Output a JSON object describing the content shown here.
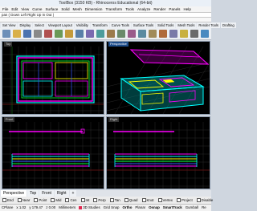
{
  "window": {
    "title": "ToolBox (3150 KB) - Rhinoceros Educational (64-bit)"
  },
  "menu": [
    "File",
    "Edit",
    "View",
    "Curve",
    "Surface",
    "Solid",
    "Mesh",
    "Dimension",
    "Transform",
    "Tools",
    "Analyze",
    "Render",
    "Panels",
    "Help"
  ],
  "command": {
    "history": "pan ( Down Left Right Up In Out )"
  },
  "toolbar_tabs": [
    "Set View",
    "Display",
    "Select",
    "Viewport Layout",
    "Visibility",
    "Transform",
    "Curve Tools",
    "Surface Tools",
    "Solid Tools",
    "Mesh Tools",
    "Render Tools",
    "Drafting"
  ],
  "toolbar_icons": [
    {
      "name": "new-icon",
      "color": "#6d8fb8"
    },
    {
      "name": "open-icon",
      "color": "#d9b04a"
    },
    {
      "name": "save-icon",
      "color": "#4a72b0"
    },
    {
      "name": "print-icon",
      "color": "#8a8a8a"
    },
    {
      "name": "cut-icon",
      "color": "#b05050"
    },
    {
      "name": "copy-icon",
      "color": "#6b9a58"
    },
    {
      "name": "paste-icon",
      "color": "#c49a3a"
    },
    {
      "name": "undo-icon",
      "color": "#5a7fa8"
    },
    {
      "name": "pan-icon",
      "color": "#7b6ab0"
    },
    {
      "name": "rotate-icon",
      "color": "#4c9c9c"
    },
    {
      "name": "zoom-icon",
      "color": "#9c7b4c"
    },
    {
      "name": "zoom-extents-icon",
      "color": "#6a8a6a"
    },
    {
      "name": "select-icon",
      "color": "#9a5a8a"
    },
    {
      "name": "layer-icon",
      "color": "#5a8aa0"
    },
    {
      "name": "properties-icon",
      "color": "#a08a5a"
    },
    {
      "name": "render-icon",
      "color": "#b06a3a"
    },
    {
      "name": "material-icon",
      "color": "#7a7aa8"
    },
    {
      "name": "light-icon",
      "color": "#c8b040"
    },
    {
      "name": "grid-icon",
      "color": "#6a6a6a"
    },
    {
      "name": "help-icon",
      "color": "#4a8ac0"
    }
  ],
  "viewports": {
    "top": {
      "label": "Top"
    },
    "perspective": {
      "label": "Perspective"
    },
    "front": {
      "label": "Front"
    },
    "right": {
      "label": "Right"
    }
  },
  "viewport_tabs": [
    "Perspective",
    "Top",
    "Front",
    "Right",
    "+"
  ],
  "osnaps": [
    "End",
    "Near",
    "Point",
    "Mid",
    "Cen",
    "Int",
    "Perp",
    "Tan",
    "Quad",
    "Knot",
    "Vertex",
    "Project",
    "Disable"
  ],
  "status": {
    "cplane": "CPlane",
    "x": "x 1.02",
    "y": "y 179.47",
    "z": "z 0.00",
    "units": "Millimeters",
    "layer": "3D Studies",
    "layer_color": "#e0284f",
    "grid_snap": "Grid Snap",
    "ortho": "Ortho",
    "planar": "Planar",
    "osnap": "Osnap",
    "smarttrack": "SmartTrack",
    "gumball": "Gumball",
    "record_history": "Re"
  },
  "colors": {
    "viewport_bg": "#000000",
    "grid": "#2a2a2a",
    "magenta": "#ff00ff",
    "cyan": "#00ffff",
    "yellow": "#ffff00",
    "green": "#00ff33",
    "blue": "#3355ff",
    "active_title": "#1e4d8a"
  }
}
